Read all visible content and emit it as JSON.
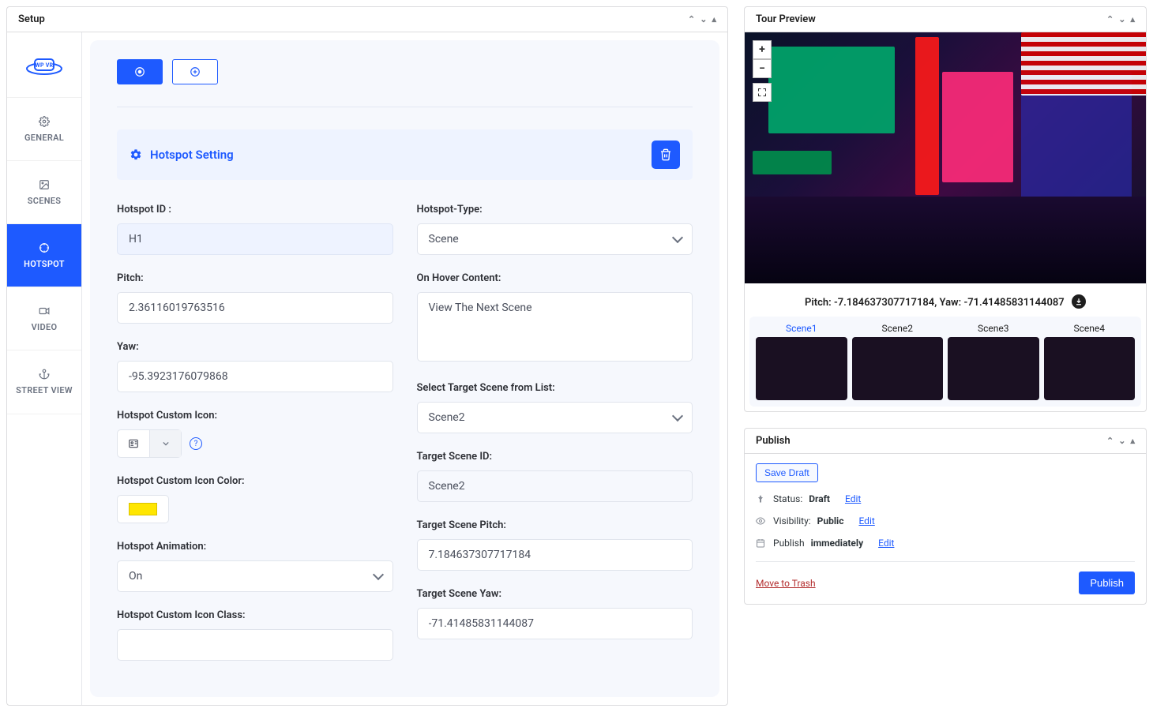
{
  "setup": {
    "title": "Setup",
    "tabs": {
      "general": "GENERAL",
      "scenes": "SCENES",
      "hotspot": "HOTSPOT",
      "video": "VIDEO",
      "streetview": "STREET VIEW"
    },
    "brand": "WP VR",
    "section_title": "Hotspot Setting",
    "labels": {
      "hotspot_id": "Hotspot ID :",
      "pitch": "Pitch:",
      "yaw": "Yaw:",
      "custom_icon": "Hotspot Custom Icon:",
      "custom_icon_color": "Hotspot Custom Icon Color:",
      "animation": "Hotspot Animation:",
      "custom_icon_class": "Hotspot Custom Icon Class:",
      "hotspot_type": "Hotspot-Type:",
      "on_hover": "On Hover Content:",
      "select_target": "Select Target Scene from List:",
      "target_id": "Target Scene ID:",
      "target_pitch": "Target Scene Pitch:",
      "target_yaw": "Target Scene Yaw:"
    },
    "values": {
      "hotspot_id": "H1",
      "pitch": "2.36116019763516",
      "yaw": "-95.3923176079868",
      "animation": "On",
      "custom_icon_class": "",
      "hotspot_type": "Scene",
      "on_hover": "View The Next Scene",
      "select_target": "Scene2",
      "target_id": "Scene2",
      "target_pitch": "7.184637307717184",
      "target_yaw": "-71.41485831144087",
      "icon_color": "#ffe600"
    }
  },
  "tour_preview": {
    "title": "Tour Preview",
    "pitch_yaw_prefix": "Pitch: ",
    "pitch_value": "-7.184637307717184",
    "yaw_prefix": ", Yaw: ",
    "yaw_value": "-71.41485831144087",
    "scenes": [
      "Scene1",
      "Scene2",
      "Scene3",
      "Scene4"
    ]
  },
  "publish": {
    "title": "Publish",
    "save_draft": "Save Draft",
    "status_label": "Status: ",
    "status_value": "Draft",
    "visibility_label": "Visibility: ",
    "visibility_value": "Public",
    "schedule_label": "Publish ",
    "schedule_value": "immediately",
    "edit": "Edit",
    "trash": "Move to Trash",
    "publish_btn": "Publish"
  }
}
